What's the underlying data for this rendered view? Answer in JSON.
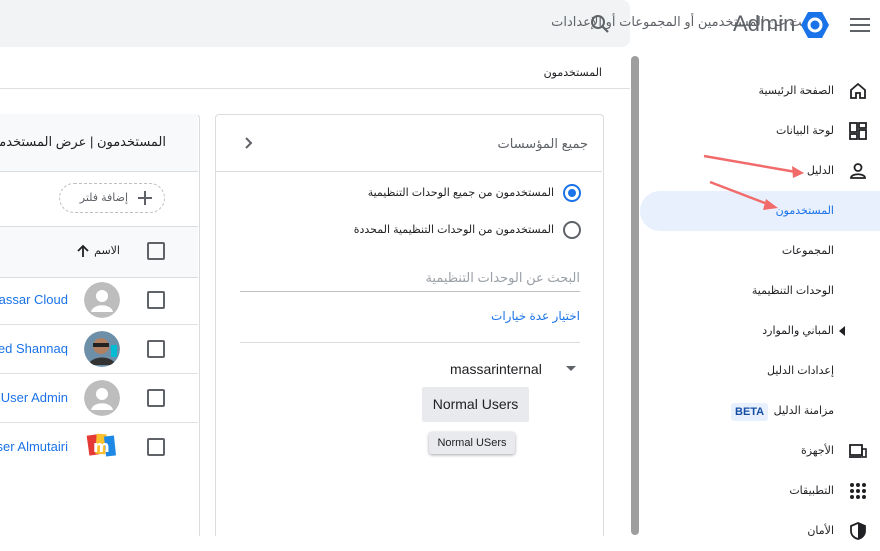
{
  "header": {
    "search_placeholder": "البحث عن المستخدمين أو المجموعات أو الإعدادات",
    "brand": "Admin",
    "breadcrumb": "المستخدمون"
  },
  "sidebar": {
    "items": [
      {
        "label": "الصفحة الرئيسية",
        "icon": "home-icon"
      },
      {
        "label": "لوحة البيانات",
        "icon": "dashboard-icon"
      },
      {
        "label": "الدليل",
        "icon": "person-icon"
      },
      {
        "label": "المستخدمون",
        "active": true
      },
      {
        "label": "المجموعات"
      },
      {
        "label": "الوحدات التنظيمية"
      },
      {
        "label": "المباني والموارد",
        "icon": "caret-left-icon"
      },
      {
        "label": "إعدادات الدليل"
      },
      {
        "label": "مزامنة الدليل",
        "badge": "BETA"
      },
      {
        "label": "الأجهزة",
        "icon": "devices-icon"
      },
      {
        "label": "التطبيقات",
        "icon": "apps-grid-icon"
      },
      {
        "label": "الأمان",
        "icon": "shield-icon"
      }
    ]
  },
  "org_panel": {
    "title": "جميع المؤسسات",
    "radio_all": "المستخدمون من جميع الوحدات التنظيمية",
    "radio_selected": "المستخدمون من الوحدات التنظيمية المحددة",
    "ou_search_placeholder": "البحث عن الوحدات التنظيمية",
    "multi_select_link": "اختيار عدة خيارات",
    "tree_root": "massarinternal",
    "tree_child": "Normal Users",
    "tooltip": "Normal USers"
  },
  "users_panel": {
    "header": "المستخدمون | عرض المستخدمين",
    "add_filter": "إضافة فلتر",
    "column_name": "الاسم",
    "rows": [
      {
        "name": "Massar Cloud",
        "avatar": "default"
      },
      {
        "name": "Waleed Shannaq",
        "avatar": "photo"
      },
      {
        "name": "User Admin",
        "avatar": "default"
      },
      {
        "name": "Yaser Almutairi",
        "avatar": "logo"
      }
    ]
  },
  "colors": {
    "accent": "#1a73e8",
    "annotation_arrow": "#f26b6b",
    "active_bg": "#e8f0fe"
  }
}
